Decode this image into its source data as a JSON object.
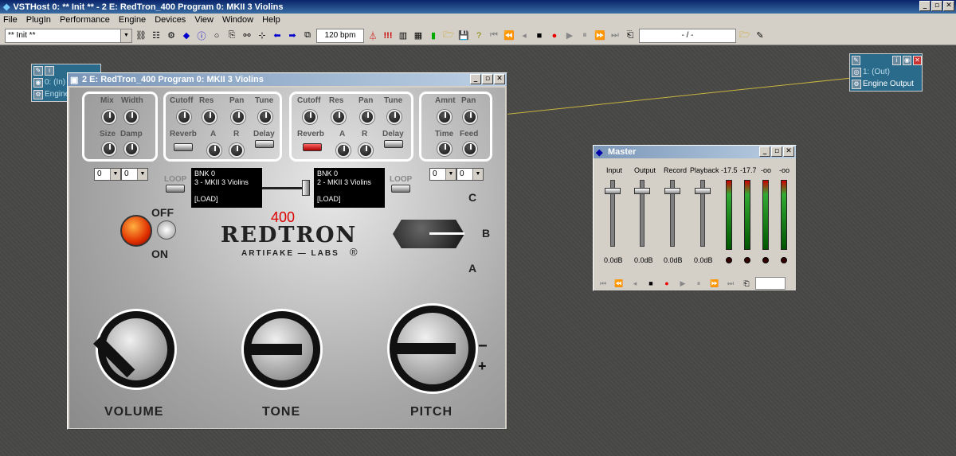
{
  "app": {
    "title": "VSTHost 0: ** Init ** - 2 E: RedTron_400 Program 0: MKII 3 Violins",
    "win_min": "_",
    "win_max": "▫",
    "win_close": "✕"
  },
  "menu": [
    "File",
    "PlugIn",
    "Performance",
    "Engine",
    "Devices",
    "View",
    "Window",
    "Help"
  ],
  "toolbar": {
    "preset": "** Init **",
    "bpm": "120 bpm",
    "position": "- / -",
    "tempo_marks": "!!!"
  },
  "nodes": {
    "input": {
      "label": "0: (In)",
      "sub": "Engine"
    },
    "output": {
      "label": "1: (Out)",
      "sub": "Engine Output"
    }
  },
  "plugin": {
    "title": "2 E: RedTron_400 Program 0: MKII 3 Violins",
    "grp1": {
      "mix": "Mix",
      "width": "Width",
      "size": "Size",
      "damp": "Damp"
    },
    "grp2": {
      "cutoff": "Cutoff",
      "res": "Res",
      "pan": "Pan",
      "tune": "Tune",
      "reverb": "Reverb",
      "a": "A",
      "r": "R",
      "delay": "Delay"
    },
    "grp3": {
      "cutoff": "Cutoff",
      "res": "Res",
      "pan": "Pan",
      "tune": "Tune",
      "reverb": "Reverb",
      "a": "A",
      "r": "R",
      "delay": "Delay"
    },
    "grp4": {
      "amnt": "Amnt",
      "pan": "Pan",
      "time": "Time",
      "feed": "Feed"
    },
    "sel": [
      "0",
      "0",
      "0",
      "0"
    ],
    "loop": "LOOP",
    "disp_left": {
      "bnk": "BNK 0",
      "patch": "3 - MKII 3 Violins",
      "load": "[LOAD]"
    },
    "disp_right": {
      "bnk": "BNK 0",
      "patch": "2 - MKII 3 Violins",
      "load": "[LOAD]"
    },
    "model": "400",
    "brand": "REDTRON",
    "maker": "ARTIFAKE — LABS",
    "reg": "®",
    "off": "OFF",
    "on": "ON",
    "pos_c": "C",
    "pos_b": "B",
    "pos_a": "A",
    "volume": "VOLUME",
    "tone": "TONE",
    "pitch": "PITCH",
    "minus": "−",
    "plus": "+"
  },
  "master": {
    "title": "Master",
    "channels": [
      "Input",
      "Output",
      "Record",
      "Playback"
    ],
    "levels": [
      "0.0dB",
      "0.0dB",
      "0.0dB",
      "0.0dB"
    ],
    "meters": [
      "-17.5",
      "-17.7",
      "-oo",
      "-oo"
    ]
  }
}
